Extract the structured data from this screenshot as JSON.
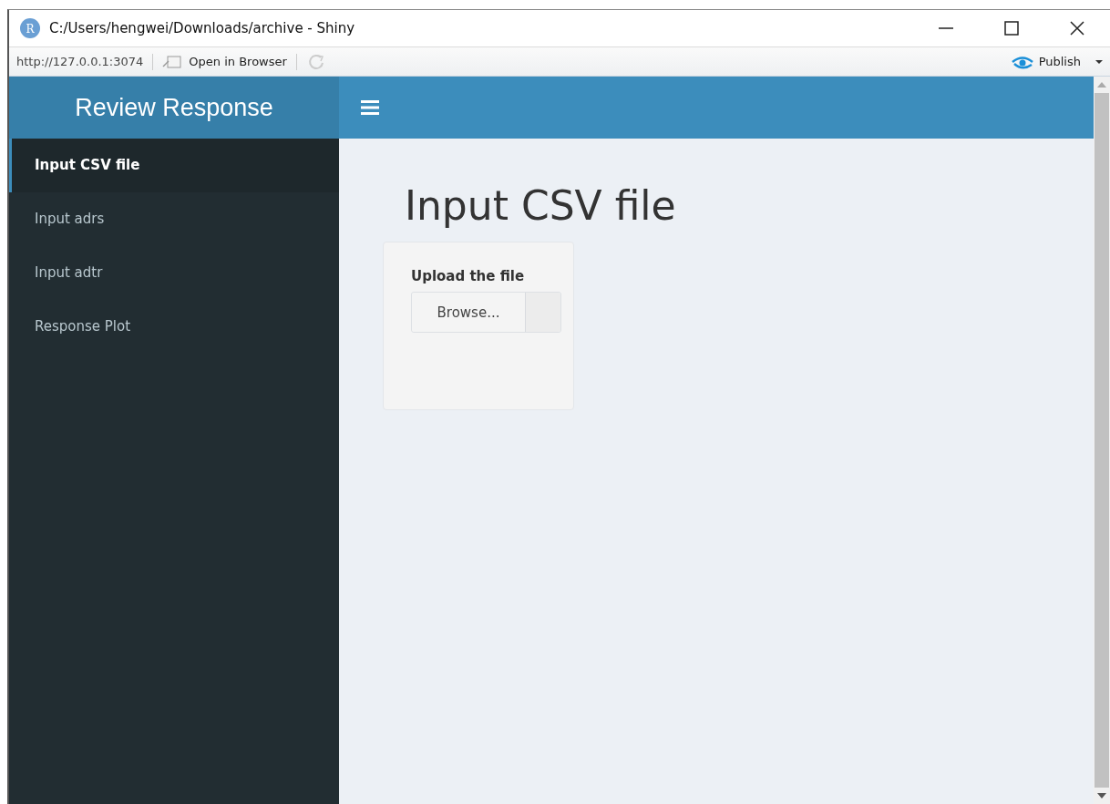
{
  "window": {
    "icon_letter": "R",
    "title": "C:/Users/hengwei/Downloads/archive - Shiny"
  },
  "toolbar": {
    "url": "http://127.0.0.1:3074",
    "open_in_browser": "Open in Browser",
    "publish": "Publish"
  },
  "header": {
    "title": "Review Response"
  },
  "sidebar": {
    "items": [
      {
        "label": "Input CSV file",
        "selected": true
      },
      {
        "label": "Input adrs",
        "selected": false
      },
      {
        "label": "Input adtr",
        "selected": false
      },
      {
        "label": "Response Plot",
        "selected": false
      }
    ]
  },
  "content": {
    "heading": "Input CSV file",
    "file_input": {
      "label": "Upload the file",
      "button": "Browse..."
    }
  }
}
